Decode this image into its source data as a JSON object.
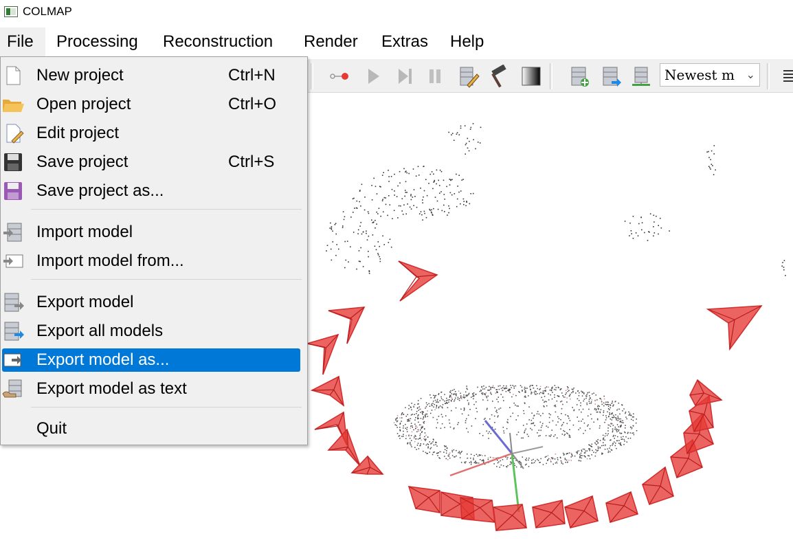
{
  "window": {
    "title": "COLMAP",
    "icon": "colmap-app-icon"
  },
  "menubar": {
    "items": [
      {
        "label": "File",
        "active": true
      },
      {
        "label": "Processing"
      },
      {
        "label": "Reconstruction"
      },
      {
        "label": "Render"
      },
      {
        "label": "Extras"
      },
      {
        "label": "Help"
      }
    ]
  },
  "file_menu": {
    "items": [
      {
        "label": "New project",
        "shortcut": "Ctrl+N",
        "icon": "new-file-icon"
      },
      {
        "label": "Open project",
        "shortcut": "Ctrl+O",
        "icon": "folder-open-icon"
      },
      {
        "label": "Edit project",
        "shortcut": "",
        "icon": "edit-file-icon"
      },
      {
        "label": "Save project",
        "shortcut": "Ctrl+S",
        "icon": "floppy-disk-icon"
      },
      {
        "label": "Save project as...",
        "shortcut": "",
        "icon": "floppy-disk-as-icon"
      },
      {
        "label": "Import model",
        "shortcut": "",
        "icon": "import-model-icon"
      },
      {
        "label": "Import model from...",
        "shortcut": "",
        "icon": "import-model-from-icon"
      },
      {
        "label": "Export model",
        "shortcut": "",
        "icon": "export-model-icon"
      },
      {
        "label": "Export all models",
        "shortcut": "",
        "icon": "export-all-models-icon"
      },
      {
        "label": "Export model as...",
        "shortcut": "",
        "icon": "export-model-as-icon",
        "highlighted": true
      },
      {
        "label": "Export model as text",
        "shortcut": "",
        "icon": "export-model-text-icon"
      },
      {
        "label": "Quit",
        "shortcut": "",
        "icon": ""
      }
    ]
  },
  "toolbar": {
    "icons": [
      "record-icon",
      "play-icon",
      "step-forward-icon",
      "pause-icon",
      "database-edit-icon",
      "hammer-icon",
      "gradient-icon",
      "database-add-icon",
      "database-export-icon",
      "database-green-icon",
      "list-icon"
    ],
    "model_select": {
      "value": "Newest m"
    }
  },
  "colors": {
    "highlight": "#0078d7",
    "camera_frustum": "#e53935",
    "menu_bg": "#f0f0f0"
  }
}
